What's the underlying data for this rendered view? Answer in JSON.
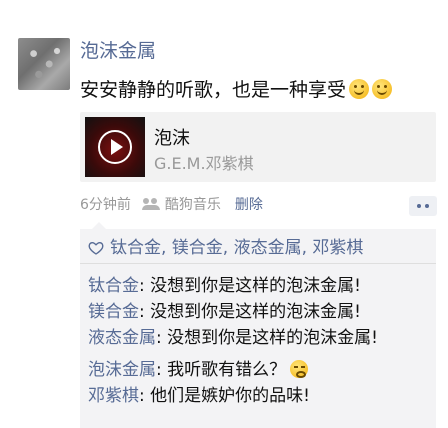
{
  "post": {
    "author": "泡沫金属",
    "text": "安安静静的听歌，也是一种享受",
    "emoji": [
      "smile-emoji",
      "smile-emoji"
    ]
  },
  "music": {
    "title": "泡沫",
    "artist": "G.E.M.邓紫棋"
  },
  "meta": {
    "time": "6分钟前",
    "source": "酷狗音乐",
    "delete_label": "删除"
  },
  "likes": {
    "names": "钛合金, 镁合金, 液态金属, 邓紫棋"
  },
  "comments": [
    {
      "author": "钛合金",
      "text": ": 没想到你是这样的泡沫金属!"
    },
    {
      "author": "镁合金",
      "text": ": 没想到你是这样的泡沫金属!"
    },
    {
      "author": "液态金属",
      "text": ": 没想到你是这样的泡沫金属!"
    },
    {
      "author": "泡沫金属",
      "text": ": 我听歌有错么？"
    },
    {
      "author": "邓紫棋",
      "text": ": 他们是嫉妒你的品味!"
    }
  ],
  "colors": {
    "link": "#576b95",
    "text": "#111111",
    "meta": "#999999",
    "panel": "#f3f3f5"
  }
}
